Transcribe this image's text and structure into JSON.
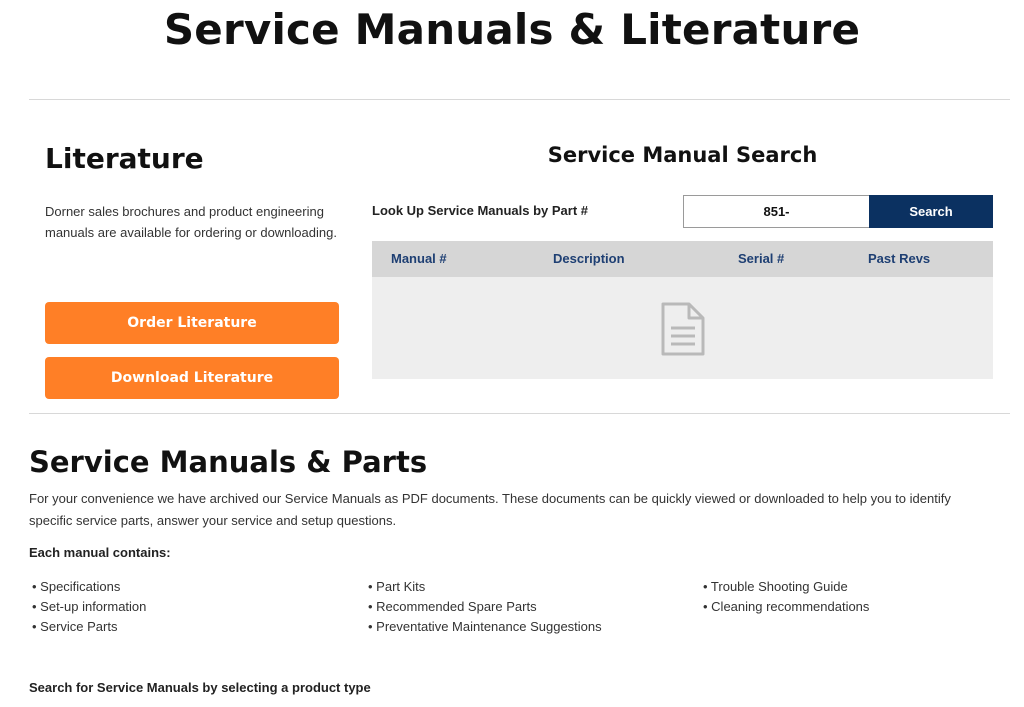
{
  "page": {
    "title": "Service Manuals & Literature"
  },
  "literature": {
    "title": "Literature",
    "description": "Dorner sales brochures and product engineering manuals are available for ordering or downloading.",
    "order_label": "Order Literature",
    "download_label": "Download Literature"
  },
  "manual_search": {
    "title": "Service Manual Search",
    "lookup_label": "Look Up Service Manuals by Part #",
    "input_value": "851-",
    "search_label": "Search",
    "columns": [
      "Manual #",
      "Description",
      "Serial #",
      "Past Revs"
    ]
  },
  "service_parts": {
    "title": "Service Manuals & Parts",
    "description": "For your convenience we have archived our Service Manuals as PDF documents. These documents can be quickly viewed or downloaded to help you to identify specific service parts, answer your service and setup questions.",
    "contains_label": "Each manual contains:",
    "features": [
      [
        "• Specifications",
        "• Set-up information",
        "• Service Parts"
      ],
      [
        "• Part Kits",
        "• Recommended Spare Parts",
        "• Preventative Maintenance Suggestions"
      ],
      [
        "• Trouble Shooting Guide",
        "• Cleaning recommendations"
      ]
    ],
    "search_type_label": "Search for Service Manuals by selecting a product type"
  },
  "colors": {
    "accent_orange": "#ff7f26",
    "navy": "#0b3161",
    "table_header_text": "#1e3f73"
  },
  "icons": {
    "empty_results": "document-icon"
  }
}
